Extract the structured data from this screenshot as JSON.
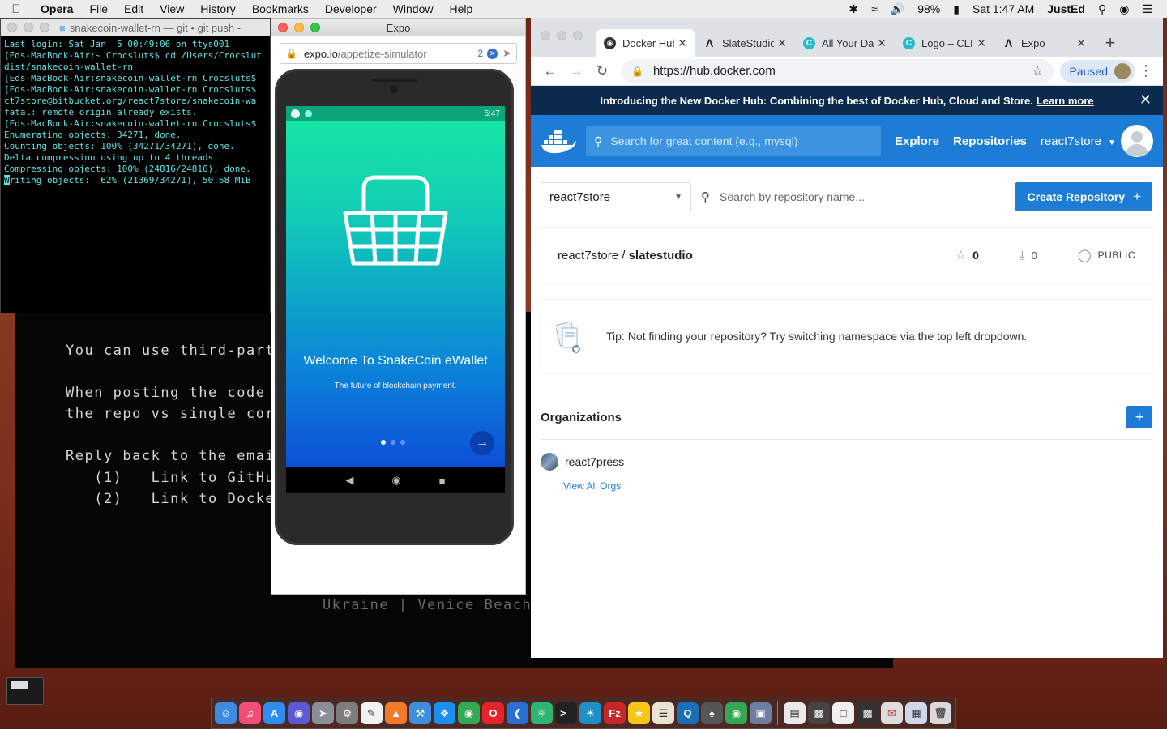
{
  "menubar": {
    "app_name": "Opera",
    "items": [
      "File",
      "Edit",
      "View",
      "History",
      "Bookmarks",
      "Developer",
      "Window",
      "Help"
    ],
    "battery": "98%",
    "clock": "Sat 1:47 AM",
    "user": "JustEd"
  },
  "terminal": {
    "title": "snakecoin-wallet-rn — git • git push -",
    "lines": [
      "Last login: Sat Jan  5 00:49:06 on ttys001",
      "[Eds-MacBook-Air:~ Crocsluts$ cd /Users/Crocslut",
      "dist/snakecoin-wallet-rn",
      "[Eds-MacBook-Air:snakecoin-wallet-rn Crocsluts$",
      "[Eds-MacBook-Air:snakecoin-wallet-rn Crocsluts$",
      "ct7store@bitbucket.org/react7store/snakecoin-wa",
      "fatal: remote origin already exists.",
      "[Eds-MacBook-Air:snakecoin-wallet-rn Crocsluts$",
      "Enumerating objects: 34271, done.",
      "Counting objects: 100% (34271/34271), done.",
      "Delta compression using up to 4 threads.",
      "Compressing objects: 100% (24816/24816), done.",
      "riting objects:  62% (21369/34271), 50.68 MiB"
    ],
    "cursor_char": "W"
  },
  "background_terminal": {
    "lines": [
      "You can use third-part",
      "When posting the code",
      "the repo vs single cor",
      "Reply back to the emai",
      "   (1)   Link to GitHub",
      "   (2)   Link to Docker"
    ],
    "footer": "Ukraine | Venice Beach"
  },
  "expo": {
    "title": "Expo",
    "url_host": "expo.io",
    "url_path": "/appetize-simulator",
    "badge_count": "2",
    "phone": {
      "clock": "5:47",
      "welcome": "Welcome To SnakeCoin eWallet",
      "tagline": "The future of blockchain payment.",
      "page_count": 3,
      "active_page": 1
    }
  },
  "chrome": {
    "tabs": [
      {
        "label": "Docker Hub",
        "icon": "docker-icon",
        "active": true
      },
      {
        "label": "SlateStudio",
        "icon": "triangle-icon",
        "active": false
      },
      {
        "label": "All Your Data",
        "icon": "cloudinary-icon",
        "active": false
      },
      {
        "label": "Logo – CLI",
        "icon": "cloudinary-icon",
        "active": false
      },
      {
        "label": "Expo",
        "icon": "triangle-icon",
        "active": false
      }
    ],
    "url": "https://hub.docker.com",
    "profile_label": "Paused"
  },
  "dockerhub": {
    "banner_text": "Introducing the New Docker Hub: Combining the best of Docker Hub, Cloud and Store.",
    "banner_link": "Learn more",
    "search_placeholder": "Search for great content (e.g., mysql)",
    "nav_explore": "Explore",
    "nav_repositories": "Repositories",
    "nav_user": "react7store",
    "namespace": "react7store",
    "repo_search_placeholder": "Search by repository name...",
    "create_button": "Create Repository",
    "repo": {
      "namespace": "react7store",
      "separator": " / ",
      "name": "slatestudio",
      "stars": "0",
      "pulls": "0",
      "visibility": "PUBLIC"
    },
    "tip": "Tip: Not finding your repository? Try switching namespace via the top left dropdown.",
    "orgs_title": "Organizations",
    "orgs": [
      {
        "name": "react7press"
      }
    ],
    "view_all": "View All Orgs"
  },
  "colors": {
    "docker_blue": "#1d7dd6",
    "banner_navy": "#0b2a4d",
    "terminal_cyan": "#5fe3e3"
  }
}
